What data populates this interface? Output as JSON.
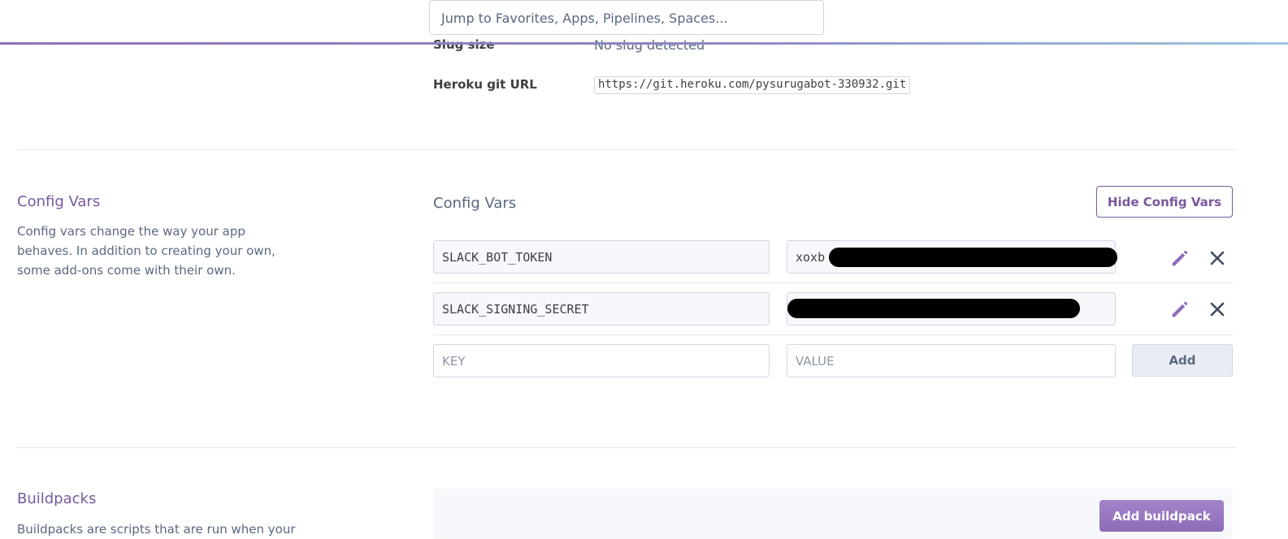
{
  "search": {
    "placeholder": "Jump to Favorites, Apps, Pipelines, Spaces..."
  },
  "info": {
    "slug_size_label": "Slug size",
    "slug_size_value": "No slug detected",
    "git_url_label": "Heroku git URL",
    "git_url_value": "https://git.heroku.com/pysurugabot-330932.git"
  },
  "config_vars": {
    "section_title": "Config Vars",
    "section_description": "Config vars change the way your app behaves. In addition to creating your own, some add-ons come with their own.",
    "panel_title": "Config Vars",
    "hide_button": "Hide Config Vars",
    "rows": [
      {
        "key": "SLACK_BOT_TOKEN",
        "value": "xoxb"
      },
      {
        "key": "SLACK_SIGNING_SECRET",
        "value": ""
      }
    ],
    "new_row": {
      "key_placeholder": "KEY",
      "value_placeholder": "VALUE",
      "add_button": "Add"
    },
    "icons": {
      "edit": "pencil-icon",
      "delete": "close-icon"
    },
    "accent_color": "#79589f"
  },
  "buildpacks": {
    "section_title": "Buildpacks",
    "section_description": "Buildpacks are scripts that are run when your",
    "add_button": "Add buildpack"
  }
}
